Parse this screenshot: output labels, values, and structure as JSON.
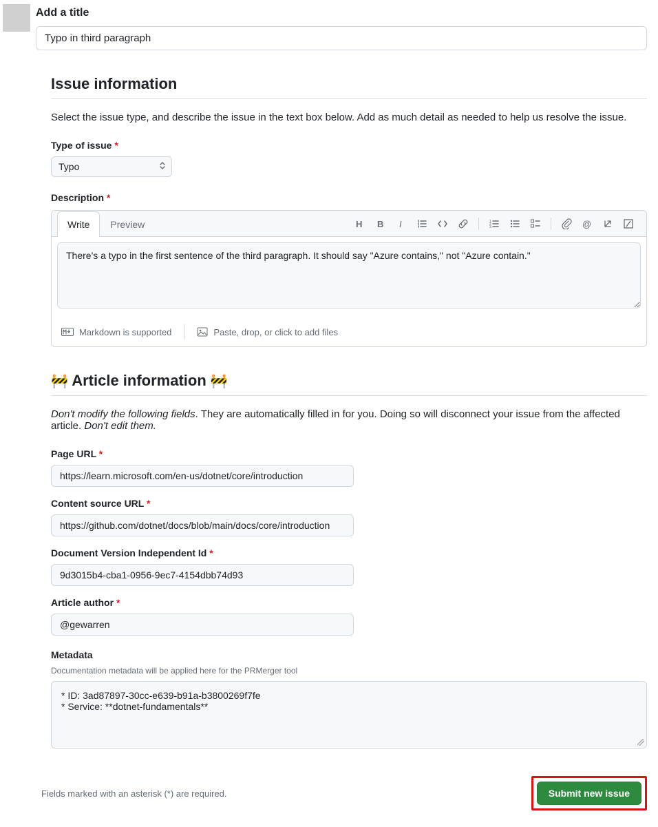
{
  "title": {
    "label": "Add a title",
    "value": "Typo in third paragraph"
  },
  "issue_info": {
    "heading": "Issue information",
    "description": "Select the issue type, and describe the issue in the text box below. Add as much detail as needed to help us resolve the issue."
  },
  "type_of_issue": {
    "label": "Type of issue",
    "selected": "Typo"
  },
  "description": {
    "label": "Description",
    "tabs": {
      "write": "Write",
      "preview": "Preview"
    },
    "value": "There's a typo in the first sentence of the third paragraph. It should say \"Azure contains,\" not \"Azure contain.\"",
    "footer": {
      "markdown": "Markdown is supported",
      "attach": "Paste, drop, or click to add files"
    }
  },
  "article_info": {
    "heading": "Article information",
    "emoji": "🚧",
    "warn_part1_italic": "Don't modify the following fields",
    "warn_part2": ". They are automatically filled in for you. Doing so will disconnect your issue from the affected article. ",
    "warn_part3_italic": "Don't edit them."
  },
  "page_url": {
    "label": "Page URL",
    "value": "https://learn.microsoft.com/en-us/dotnet/core/introduction"
  },
  "content_source_url": {
    "label": "Content source URL",
    "value": "https://github.com/dotnet/docs/blob/main/docs/core/introduction"
  },
  "doc_version_id": {
    "label": "Document Version Independent Id",
    "value": "9d3015b4-cba1-0956-9ec7-4154dbb74d93"
  },
  "article_author": {
    "label": "Article author",
    "value": "@gewarren"
  },
  "metadata": {
    "label": "Metadata",
    "help": "Documentation metadata will be applied here for the PRMerger tool",
    "line1": "* ID: 3ad87897-30cc-e639-b91a-b3800269f7fe",
    "line2": "* Service: **dotnet-fundamentals**"
  },
  "footer": {
    "note": "Fields marked with an asterisk (*) are required.",
    "submit": "Submit new issue"
  }
}
